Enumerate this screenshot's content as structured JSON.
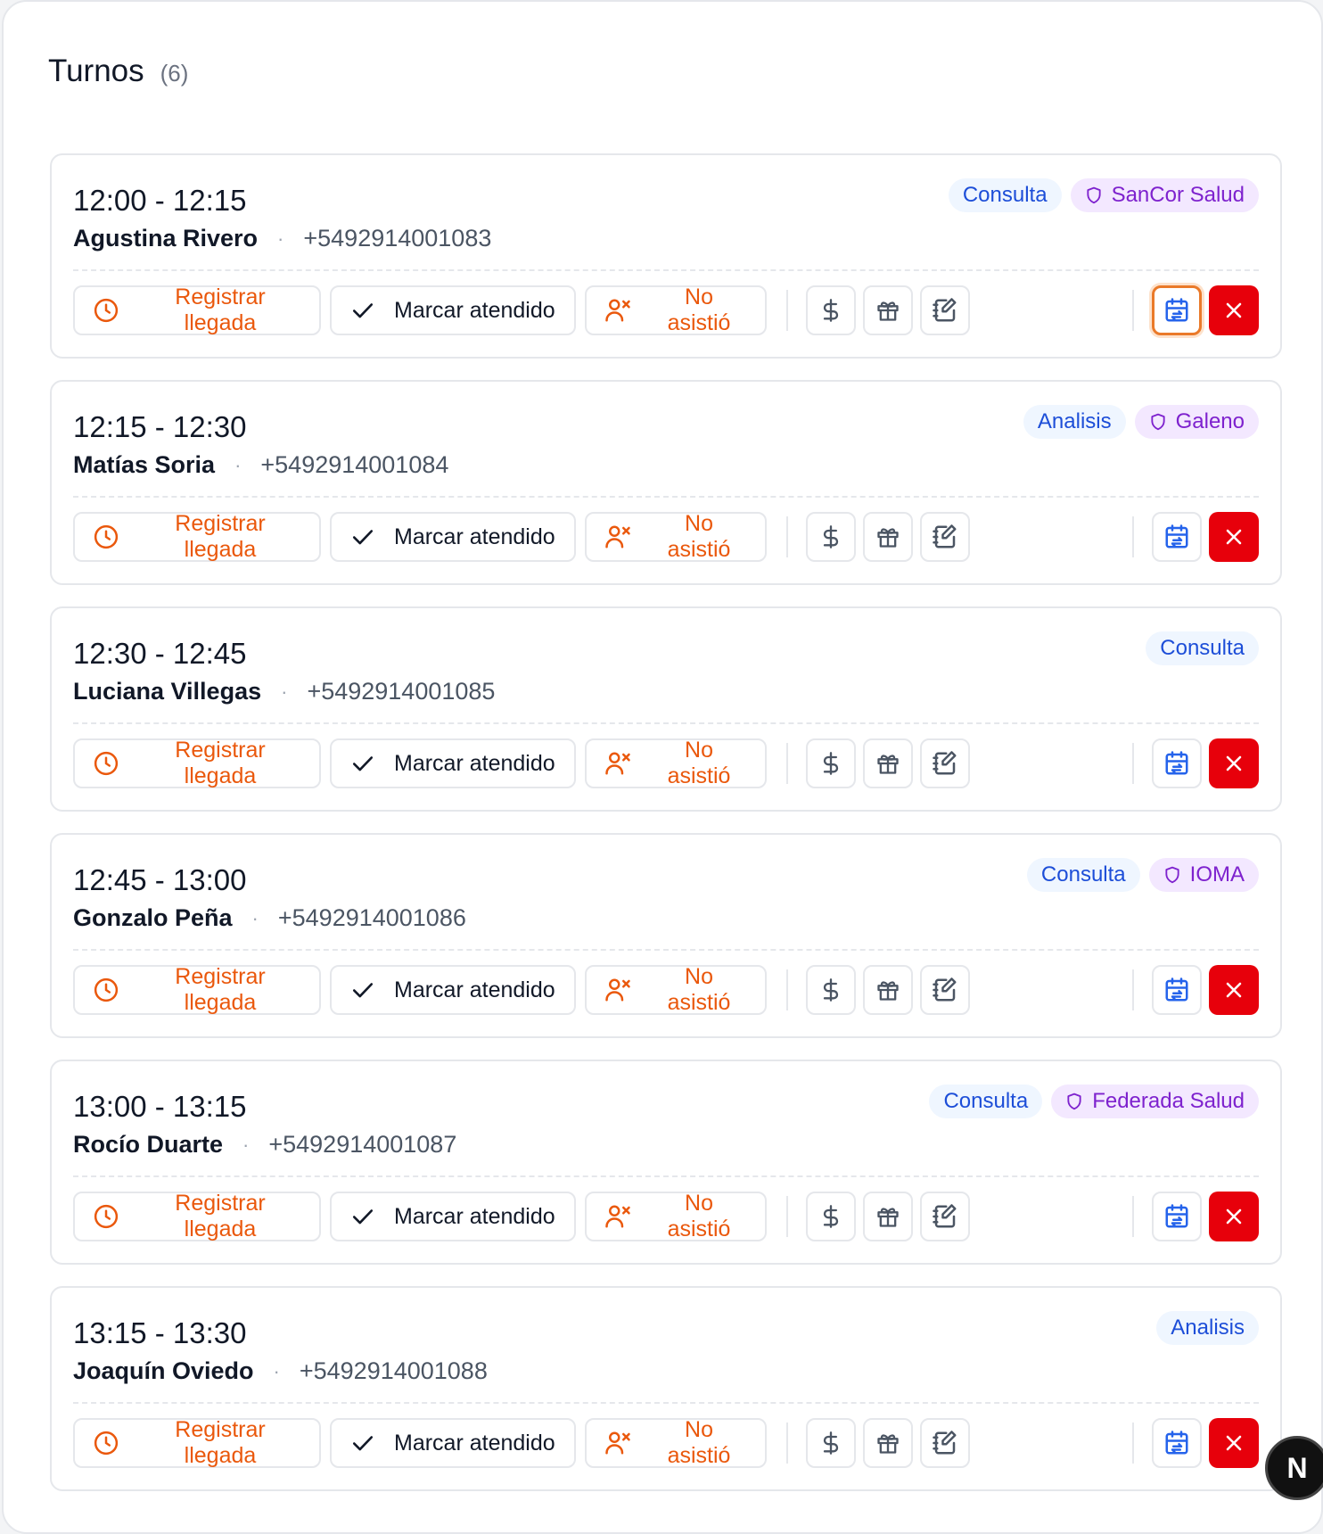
{
  "header": {
    "title": "Turnos",
    "count": "(6)"
  },
  "actions": {
    "arrive_label": "Registrar llegada",
    "done_label": "Marcar atendido",
    "noshow_label": "No asistió"
  },
  "appointments": [
    {
      "time": "12:00 - 12:15",
      "name": "Agustina Rivero",
      "phone": "+5492914001083",
      "type": "Consulta",
      "insurance": "SanCor Salud"
    },
    {
      "time": "12:15 - 12:30",
      "name": "Matías Soria",
      "phone": "+5492914001084",
      "type": "Analisis",
      "insurance": "Galeno"
    },
    {
      "time": "12:30 - 12:45",
      "name": "Luciana Villegas",
      "phone": "+5492914001085",
      "type": "Consulta",
      "insurance": ""
    },
    {
      "time": "12:45 - 13:00",
      "name": "Gonzalo Peña",
      "phone": "+5492914001086",
      "type": "Consulta",
      "insurance": "IOMA"
    },
    {
      "time": "13:00 - 13:15",
      "name": "Rocío Duarte",
      "phone": "+5492914001087",
      "type": "Consulta",
      "insurance": "Federada Salud"
    },
    {
      "time": "13:15 - 13:30",
      "name": "Joaquín Oviedo",
      "phone": "+5492914001088",
      "type": "Analisis",
      "insurance": ""
    }
  ],
  "fab": {
    "label": "N"
  },
  "colors": {
    "accent": "#ea580c",
    "danger": "#e7000b",
    "type_tag": "#1d4ed8",
    "insurance_tag": "#7e22ce"
  },
  "icons": [
    "clock-icon",
    "check-icon",
    "user-x-icon",
    "dollar-icon",
    "gift-icon",
    "edit-note-icon",
    "calendar-reschedule-icon",
    "close-icon",
    "shield-icon"
  ]
}
